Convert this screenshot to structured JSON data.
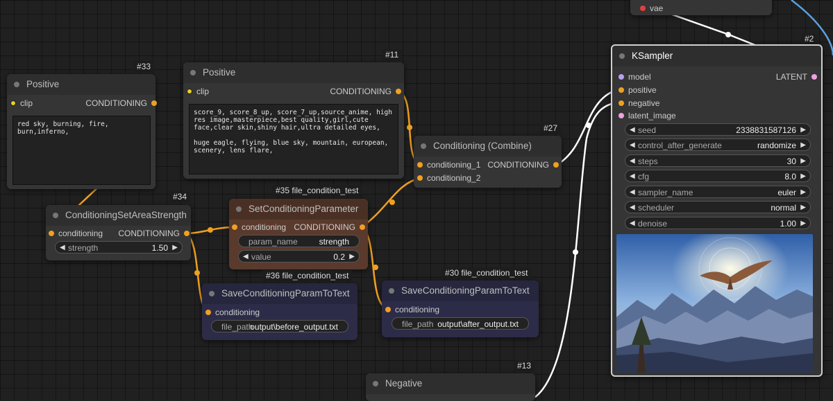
{
  "nodes": {
    "pos33": {
      "badge": "#33",
      "title": "Positive",
      "input_clip": "clip",
      "output": "CONDITIONING",
      "text": "red sky, burning, fire, burn,inferno,"
    },
    "pos11": {
      "badge": "#11",
      "title": "Positive",
      "input_clip": "clip",
      "output": "CONDITIONING",
      "text": "score_9, score_8_up, score_7_up,source_anime, high res image,masterpiece,best quality,girl,cute face,clear skin,shiny hair,ultra detailed eyes,\n\nhuge eagle, flying, blue sky, mountain, european, scenery, lens flare,"
    },
    "combine27": {
      "badge": "#27",
      "title": "Conditioning (Combine)",
      "input1": "conditioning_1",
      "input2": "conditioning_2",
      "output": "CONDITIONING"
    },
    "area34": {
      "badge": "#34",
      "title": "ConditioningSetAreaStrength",
      "input": "conditioning",
      "output": "CONDITIONING",
      "widget_label": "strength",
      "widget_value": "1.50"
    },
    "setparam35": {
      "badge": "#35 file_condition_test",
      "title": "SetConditioningParameter",
      "input": "conditioning",
      "output": "CONDITIONING",
      "w1_label": "param_name",
      "w1_value": "strength",
      "w2_label": "value",
      "w2_value": "0.2"
    },
    "save36": {
      "badge": "#36 file_condition_test",
      "title": "SaveConditioningParamToText",
      "input": "conditioning",
      "w_label": "file_path",
      "w_value": "output\\before_output.txt"
    },
    "save30": {
      "badge": "#30 file_condition_test",
      "title": "SaveConditioningParamToText",
      "input": "conditioning",
      "w_label": "file_path",
      "w_value": "output\\after_output.txt"
    },
    "neg13": {
      "badge": "#13",
      "title": "Negative"
    },
    "vae_node": {
      "input": "vae"
    },
    "ksampler2": {
      "badge": "#2",
      "title": "KSampler",
      "inputs": [
        "model",
        "positive",
        "negative",
        "latent_image"
      ],
      "output": "LATENT",
      "widgets": [
        {
          "label": "seed",
          "value": "2338831587126"
        },
        {
          "label": "control_after_generate",
          "value": "randomize"
        },
        {
          "label": "steps",
          "value": "30"
        },
        {
          "label": "cfg",
          "value": "8.0"
        },
        {
          "label": "sampler_name",
          "value": "euler"
        },
        {
          "label": "scheduler",
          "value": "normal"
        },
        {
          "label": "denoise",
          "value": "1.00"
        }
      ]
    }
  },
  "colors": {
    "canvas": "#202020",
    "node": "#353535",
    "conditioning_wire": "#f0a020",
    "setparam_node": "#5a3a2c",
    "save_node": "#2c2c48",
    "ksampler_border": "#d0d0d0"
  }
}
